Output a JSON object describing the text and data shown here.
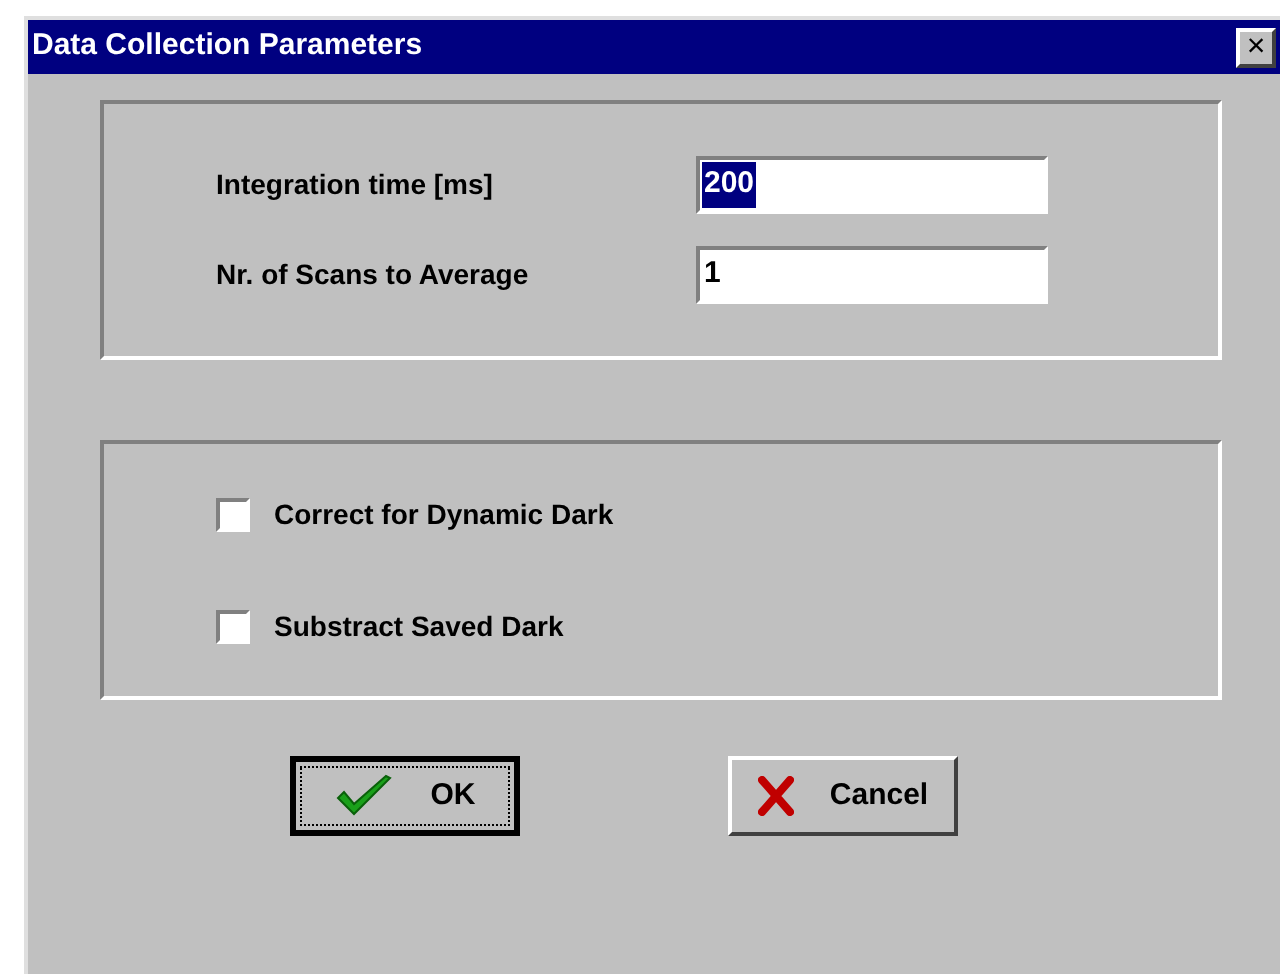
{
  "window": {
    "title": "Data Collection Parameters",
    "close": "×"
  },
  "fields": [
    {
      "label": "Integration time [ms]",
      "value": "200",
      "text_selected": true
    },
    {
      "label": "Nr. of Scans to Average",
      "value": "1",
      "text_selected": false
    }
  ],
  "options": [
    {
      "label": "Correct for Dynamic Dark",
      "checked": false
    },
    {
      "label": "Substract Saved Dark",
      "checked": false
    }
  ],
  "buttons": [
    {
      "label": "OK",
      "kind": "ok",
      "default": true
    },
    {
      "label": "Cancel",
      "kind": "cancel",
      "default": false
    }
  ]
}
